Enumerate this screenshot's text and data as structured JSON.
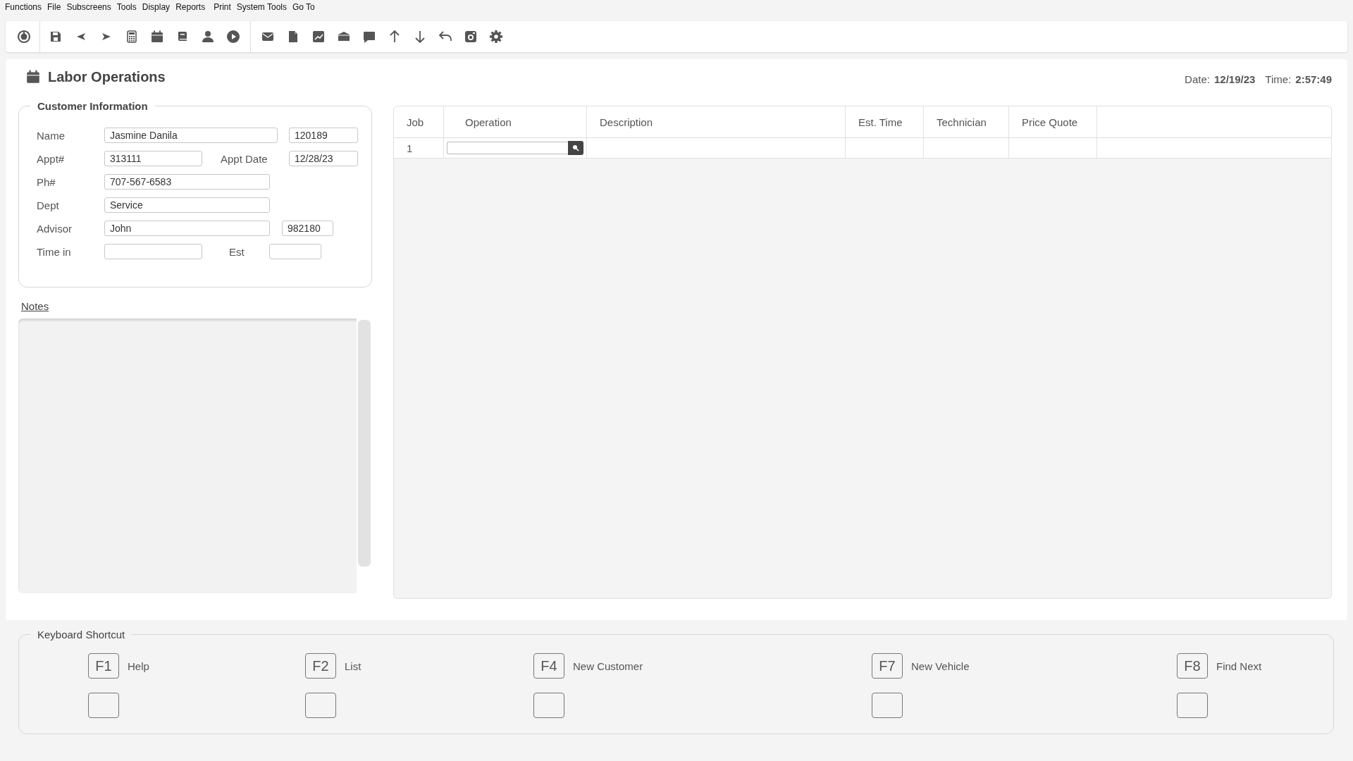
{
  "menu": [
    "Functions",
    "File",
    "Subscreens",
    "Tools",
    "Display",
    "Reports",
    "Print",
    "System Tools",
    "Go To"
  ],
  "header": {
    "title": "Labor Operations",
    "date_label": "Date:",
    "date": "12/19/23",
    "time_label": "Time:",
    "time": "2:57:49"
  },
  "customer_info": {
    "title": "Customer Information",
    "rows": [
      [
        {
          "kind": "label",
          "text": "Name"
        },
        {
          "kind": "input",
          "value": "Jasmine Danila"
        },
        {
          "kind": "input",
          "value": "120189"
        }
      ],
      [
        {
          "kind": "label",
          "text": "Appt#"
        },
        {
          "kind": "input",
          "value": "313111"
        },
        {
          "kind": "label",
          "text": "Appt Date"
        },
        {
          "kind": "input",
          "value": "12/28/23"
        }
      ],
      [
        {
          "kind": "label",
          "text": "Ph#"
        },
        {
          "kind": "input",
          "value": "707-567-6583"
        }
      ],
      [
        {
          "kind": "label",
          "text": "Dept"
        },
        {
          "kind": "input",
          "value": "Service"
        }
      ],
      [
        {
          "kind": "label",
          "text": "Advisor"
        },
        {
          "kind": "input",
          "value": "John"
        },
        {
          "kind": "input",
          "value": "982180"
        }
      ],
      [
        {
          "kind": "label",
          "text": "Time in"
        },
        {
          "kind": "input"
        },
        {
          "kind": "label",
          "text": "Est"
        },
        {
          "kind": "input"
        }
      ]
    ]
  },
  "notes": {
    "label": "Notes"
  },
  "table": {
    "columns": [
      "Job",
      "Operation",
      "Description",
      "Est. Time",
      "Technician",
      "Price Quote"
    ],
    "rows": [
      {
        "job": "1"
      }
    ]
  },
  "keyboard_shortcut": {
    "title": "Keyboard Shortcut",
    "shortcuts": [
      {
        "key": "F1",
        "label": "Help"
      },
      {
        "key": "F2",
        "label": "List"
      },
      {
        "key": "F4",
        "label": "New Customer"
      },
      {
        "key": "F7",
        "label": "New Vehicle"
      },
      {
        "key": "F8",
        "label": "Find Next"
      }
    ]
  }
}
